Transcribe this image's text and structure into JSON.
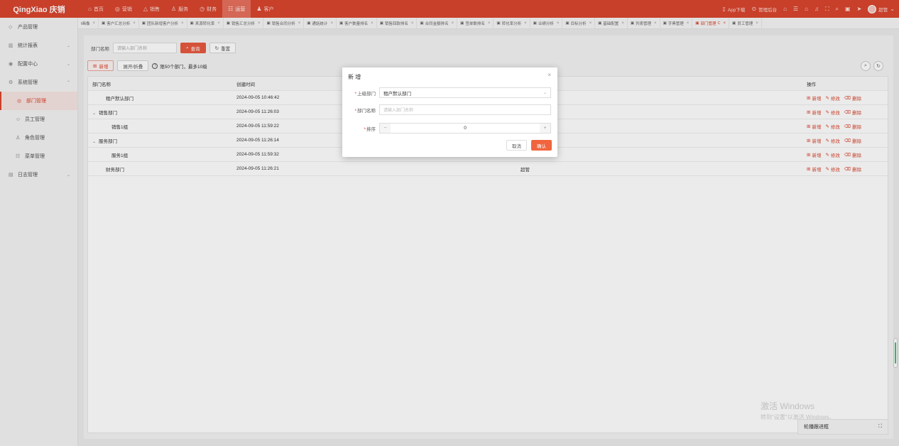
{
  "brand": "QingXiao 庆销",
  "topnav": [
    {
      "icon": "⌂",
      "icon_name": "home-icon",
      "label": "首页"
    },
    {
      "icon": "◎",
      "icon_name": "target-icon",
      "label": "营销"
    },
    {
      "icon": "△",
      "icon_name": "sales-icon",
      "label": "销售"
    },
    {
      "icon": "♙",
      "icon_name": "service-icon",
      "label": "服务"
    },
    {
      "icon": "◷",
      "icon_name": "finance-icon",
      "label": "财务"
    },
    {
      "icon": "☷",
      "icon_name": "operation-icon",
      "label": "运营",
      "active": true
    },
    {
      "icon": "♟",
      "icon_name": "customer-icon",
      "label": "客户"
    }
  ],
  "topright": {
    "app_download": "App下载",
    "manage_backend": "管理后台",
    "user_name": "超管"
  },
  "sidebar": {
    "items": [
      {
        "label": "产品管理",
        "icon": "◇",
        "icon_name": "product-icon",
        "chevron": ""
      },
      {
        "label": "统计报表",
        "icon": "▥",
        "icon_name": "report-icon",
        "chevron": "⌄"
      },
      {
        "label": "配置中心",
        "icon": "◉",
        "icon_name": "config-icon",
        "chevron": "⌄"
      },
      {
        "label": "系统管理",
        "icon": "⚙",
        "icon_name": "system-icon",
        "chevron": "⌃"
      },
      {
        "label": "部门管理",
        "icon": "◎",
        "icon_name": "department-icon",
        "chevron": "",
        "sub": true,
        "active": true
      },
      {
        "label": "员工管理",
        "icon": "☺",
        "icon_name": "employee-icon",
        "chevron": "",
        "sub": true
      },
      {
        "label": "角色管理",
        "icon": "♙",
        "icon_name": "role-icon",
        "chevron": "",
        "sub": true
      },
      {
        "label": "菜单管理",
        "icon": "☷",
        "icon_name": "menu-icon",
        "chevron": "",
        "sub": true
      },
      {
        "label": "日志管理",
        "icon": "▤",
        "icon_name": "log-icon",
        "chevron": "⌄"
      }
    ]
  },
  "tabs": [
    {
      "label": "f画像"
    },
    {
      "label": "客户汇总分析"
    },
    {
      "label": "团队新增客户分析"
    },
    {
      "label": "来源转化率"
    },
    {
      "label": "销售汇总分析"
    },
    {
      "label": "销售合同分析"
    },
    {
      "label": "通話统计"
    },
    {
      "label": "客户数量排名"
    },
    {
      "label": "销售回款排名"
    },
    {
      "label": "合同金额排名"
    },
    {
      "label": "签单数排名"
    },
    {
      "label": "转化率分析"
    },
    {
      "label": "业绩分析"
    },
    {
      "label": "目标分析"
    },
    {
      "label": "基础配置"
    },
    {
      "label": "列表管理"
    },
    {
      "label": "字典管理"
    },
    {
      "label": "部门管理",
      "active": true,
      "refresh": "C"
    },
    {
      "label": "员工管理"
    }
  ],
  "search": {
    "label": "部门名称",
    "placeholder": "请输入部门名称",
    "query_btn": "查询",
    "reset_btn": "重置"
  },
  "toolbar": {
    "add_btn": "新增",
    "expand_btn": "展开/折叠",
    "hint": "限50个部门，最多10级"
  },
  "table": {
    "headers": [
      "部门名称",
      "创建时间",
      "",
      "操作"
    ],
    "rows": [
      {
        "name": "租户默认部门",
        "caret": "",
        "level": "lvl0",
        "time": "2024-09-05 10:46:42",
        "extra": "理员"
      },
      {
        "name": "销售部门",
        "caret": "⌄",
        "level": "lvl0e",
        "time": "2024-09-05 11:26:03",
        "extra": ""
      },
      {
        "name": "销售1组",
        "caret": "",
        "level": "lvl1",
        "time": "2024-09-05 11:59:22",
        "extra": ""
      },
      {
        "name": "服务部门",
        "caret": "⌄",
        "level": "lvl0e",
        "time": "2024-09-05 11:26:14",
        "extra": ""
      },
      {
        "name": "服务1组",
        "caret": "",
        "level": "lvl1",
        "time": "2024-09-05 11:59:32",
        "extra": ""
      },
      {
        "name": "财务部门",
        "caret": "",
        "level": "lvl0",
        "time": "2024-09-05 11:26:21",
        "extra": "超管"
      }
    ],
    "ops": {
      "add": "新增",
      "edit": "修改",
      "delete": "删除"
    }
  },
  "modal": {
    "title": "新 增",
    "parent_label": "上级部门",
    "parent_value": "租户默认部门",
    "name_label": "部门名称",
    "name_placeholder": "请输入部门名称",
    "sort_label": "排序",
    "sort_value": "0",
    "cancel": "取消",
    "confirm": "确认"
  },
  "watermark": {
    "line1": "激活 Windows",
    "line2": "转到\"设置\"以激活 Windows。"
  },
  "float_panel": {
    "label": "轮播跟进框"
  }
}
